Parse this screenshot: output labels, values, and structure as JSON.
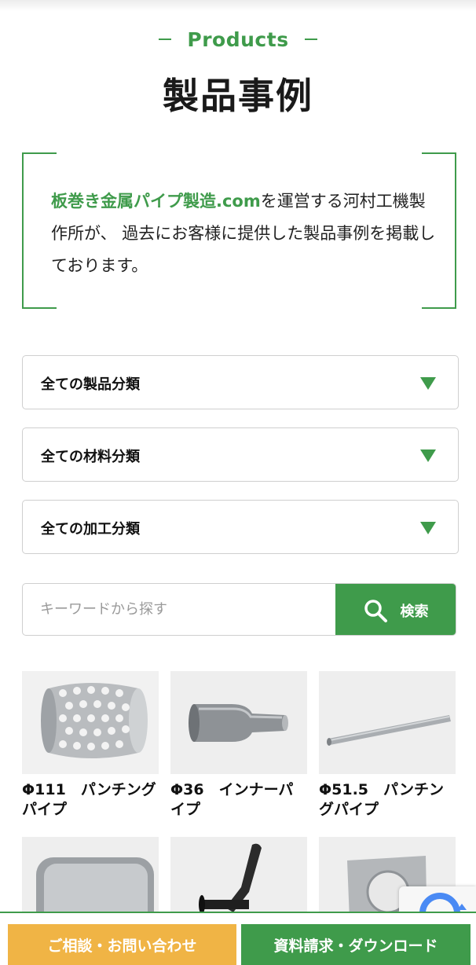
{
  "header": {
    "section_en": "Products",
    "title": "製品事例"
  },
  "intro": {
    "highlight": "板巻き金属パイプ製造.com",
    "text": "を運営する河村工機製作所が、 過去にお客様に提供した製品事例を掲載しております。"
  },
  "filters": [
    {
      "label": "全ての製品分類",
      "icon": "triangle-down-icon"
    },
    {
      "label": "全ての材料分類",
      "icon": "triangle-down-icon"
    },
    {
      "label": "全ての加工分類",
      "icon": "triangle-down-icon"
    }
  ],
  "search": {
    "placeholder": "キーワードから探す",
    "button_label": "検索",
    "icon": "search-icon"
  },
  "products": [
    {
      "name": "Φ111　パンチングパイプ"
    },
    {
      "name": "Φ36　インナーパイプ"
    },
    {
      "name": "Φ51.5　パンチングパイプ"
    },
    {
      "name": ""
    },
    {
      "name": ""
    },
    {
      "name": ""
    }
  ],
  "cta": {
    "consult_label": "ご相談・お問い合わせ",
    "docs_label": "資料請求・ダウンロード"
  },
  "colors": {
    "accent": "#3f9b4b",
    "cta_orange": "#f0b445"
  }
}
